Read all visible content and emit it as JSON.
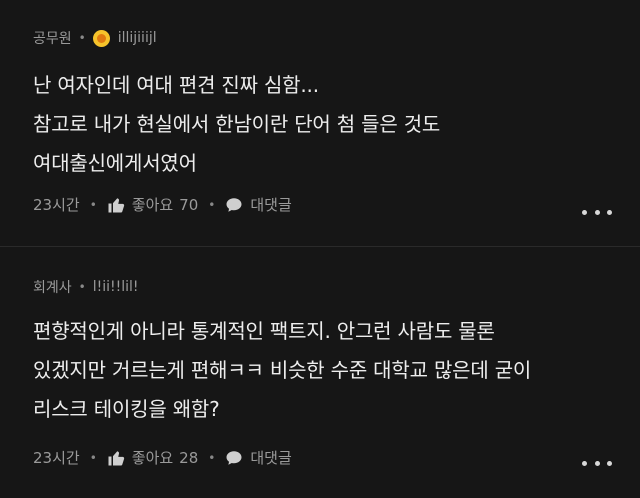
{
  "comments": [
    {
      "author": "공무원",
      "nickname": "illijiiijl",
      "badge_icon": "gold-badge-icon",
      "lines": [
        "난 여자인데 여대 편견 진짜 심함...",
        "참고로 내가 현실에서 한남이란 단어 첨 들은 것도",
        "여대출신에게서였어"
      ],
      "time": "23시간",
      "like_label": "좋아요",
      "like_count": "70",
      "reply_label": "대댓글"
    },
    {
      "author": "회계사",
      "nickname": "l!ii!!lil!",
      "lines": [
        "편향적인게 아니라 통계적인 팩트지. 안그런 사람도 물론",
        "있겠지만 거르는게 편해ㅋㅋ 비슷한 수준 대학교 많은데 굳이",
        "리스크 테이킹을 왜함?"
      ],
      "time": "23시간",
      "like_label": "좋아요",
      "like_count": "28",
      "reply_label": "대댓글"
    }
  ],
  "separator_char": "•",
  "colors": {
    "background": "#161616",
    "text": "#ededed",
    "meta": "#9a9a9a",
    "badge": "#f6c32b"
  }
}
